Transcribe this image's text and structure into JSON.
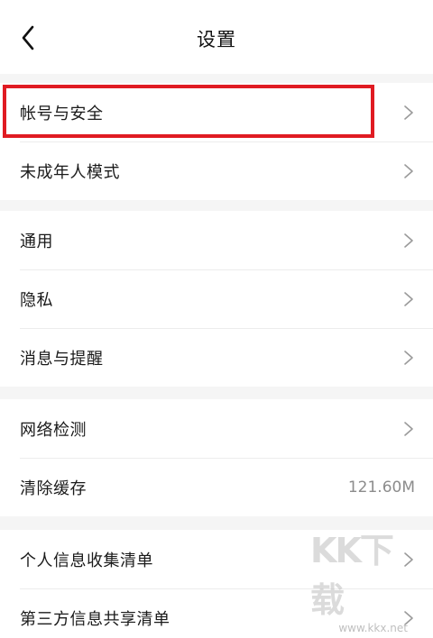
{
  "header": {
    "title": "设置"
  },
  "groups": [
    {
      "items": [
        {
          "label": "帐号与安全"
        },
        {
          "label": "未成年人模式"
        }
      ]
    },
    {
      "items": [
        {
          "label": "通用"
        },
        {
          "label": "隐私"
        },
        {
          "label": "消息与提醒"
        }
      ]
    },
    {
      "items": [
        {
          "label": "网络检测"
        },
        {
          "label": "清除缓存",
          "value": "121.60M"
        }
      ]
    },
    {
      "items": [
        {
          "label": "个人信息收集清单"
        },
        {
          "label": "第三方信息共享清单"
        }
      ]
    }
  ],
  "watermark": {
    "letters": "KK下载",
    "url": "www.kkx.net"
  },
  "colors": {
    "highlight": "#e01b22",
    "divider": "#ececec",
    "background": "#f5f5f5",
    "value_text": "#8c8c8c"
  }
}
